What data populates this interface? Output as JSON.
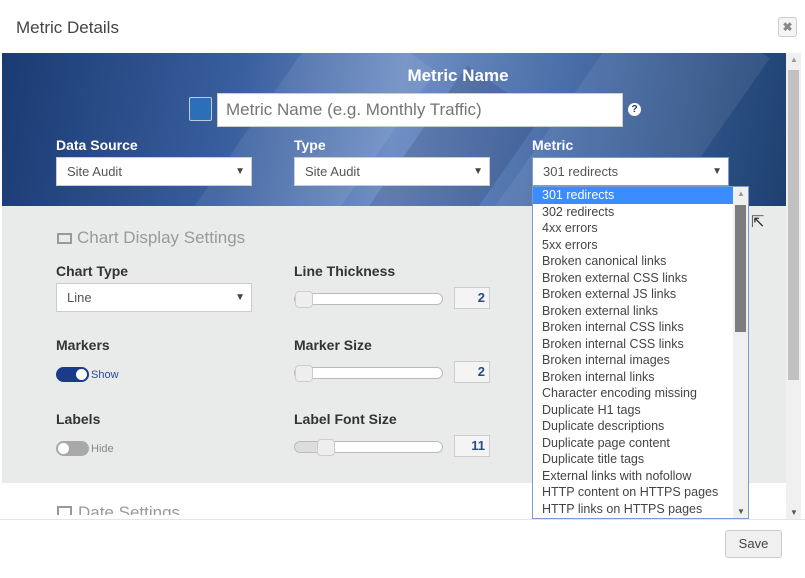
{
  "modal": {
    "title": "Metric Details",
    "close_icon": "close-icon",
    "save_label": "Save"
  },
  "header": {
    "metric_name_label": "Metric Name",
    "metric_name_placeholder": "Metric Name (e.g. Monthly Traffic)",
    "metric_name_value": "",
    "color": "#2a6fb8",
    "help": "?",
    "data_source": {
      "label": "Data Source",
      "value": "Site Audit"
    },
    "type": {
      "label": "Type",
      "value": "Site Audit"
    },
    "metric": {
      "label": "Metric",
      "value": "301 redirects"
    }
  },
  "metric_options": [
    "301 redirects",
    "302 redirects",
    "4xx errors",
    "5xx errors",
    "Broken canonical links",
    "Broken external CSS links",
    "Broken external JS links",
    "Broken external links",
    "Broken internal CSS links",
    "Broken internal CSS links",
    "Broken internal images",
    "Broken internal links",
    "Character encoding missing",
    "Duplicate H1 tags",
    "Duplicate descriptions",
    "Duplicate page content",
    "Duplicate title tags",
    "External links with nofollow",
    "HTTP content on HTTPS pages",
    "HTTP links on HTTPS pages"
  ],
  "chart_settings": {
    "heading": "Chart Display Settings",
    "chart_type": {
      "label": "Chart Type",
      "value": "Line"
    },
    "line_thickness": {
      "label": "Line Thickness",
      "value": "2"
    },
    "markers": {
      "label": "Markers",
      "state": "Show",
      "on": true
    },
    "marker_size": {
      "label": "Marker Size",
      "value": "2"
    },
    "labels": {
      "label": "Labels",
      "state": "Hide",
      "on": false
    },
    "label_font_size": {
      "label": "Label Font Size",
      "value": "11"
    }
  },
  "data_settings": {
    "heading": "Date Settings"
  }
}
